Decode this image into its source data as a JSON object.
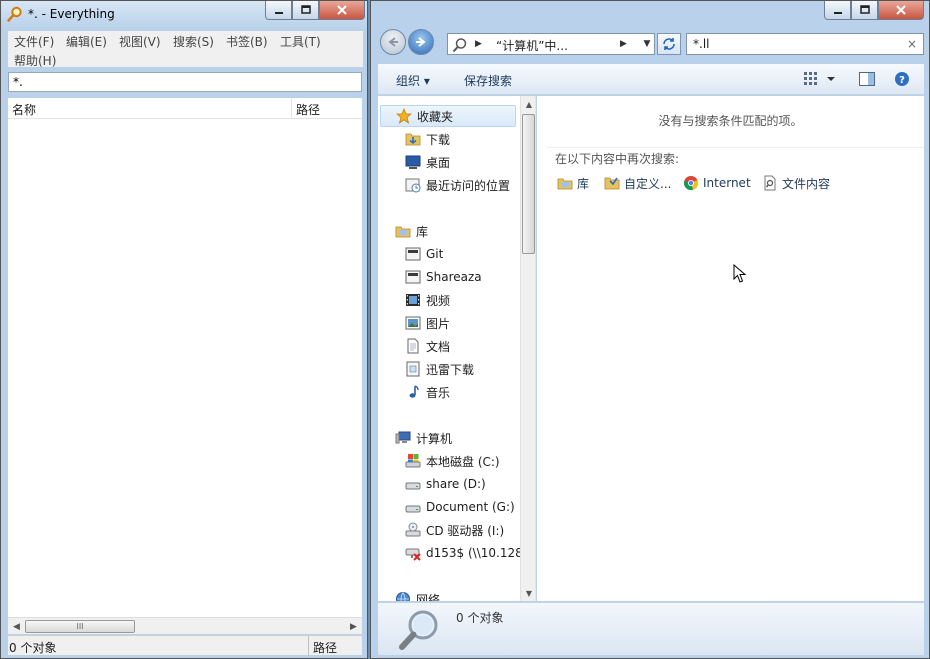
{
  "everything": {
    "title": "*. - Everything",
    "menu": [
      "文件(F)",
      "编辑(E)",
      "视图(V)",
      "搜索(S)",
      "书签(B)",
      "工具(T)",
      "帮助(H)"
    ],
    "search_value": "*.",
    "columns": [
      "名称",
      "路径"
    ],
    "scroll_thumb_label": "III",
    "status_left": "0 个对象",
    "status_right": "路径"
  },
  "explorer": {
    "address_text": "“计算机”中...",
    "search_value": "*.ll",
    "clear_glyph": "×",
    "toolbar": {
      "organize": "组织 ▾",
      "save_search": "保存搜索"
    },
    "nav": {
      "favorites": "收藏夹",
      "favorites_items": [
        "下载",
        "桌面",
        "最近访问的位置"
      ],
      "libraries": "库",
      "library_items": [
        "Git",
        "Shareaza",
        "视频",
        "图片",
        "文档",
        "迅雷下载",
        "音乐"
      ],
      "computer": "计算机",
      "computer_items": [
        "本地磁盘 (C:)",
        "share (D:)",
        "Document (G:)",
        "CD 驱动器 (I:)",
        "d153$ (\\\\10.128"
      ],
      "network": "网络"
    },
    "no_match": "没有与搜索条件匹配的项。",
    "search_again": "在以下内容中再次搜索:",
    "search_again_options": [
      "库",
      "自定义...",
      "Internet",
      "文件内容"
    ],
    "details": "0 个对象"
  },
  "colors": {
    "frame": "#b9d1ea",
    "desktop": "#6a8fb5",
    "close_red": "#c9553f",
    "link_blue": "#1e395b"
  }
}
